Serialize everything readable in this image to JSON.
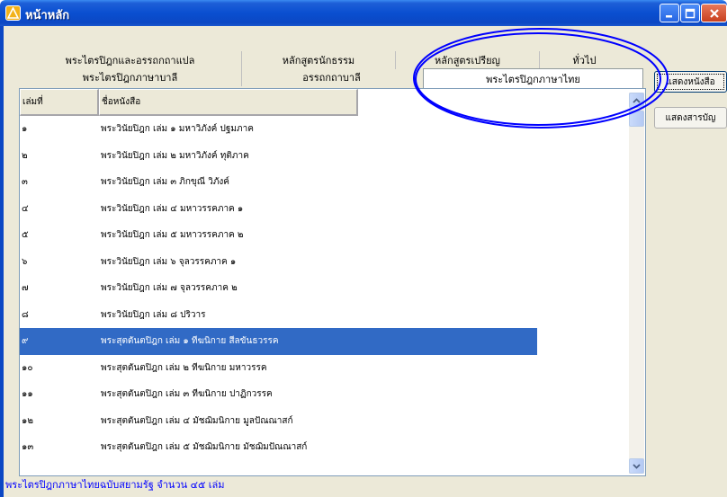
{
  "window": {
    "title": "หน้าหลัก"
  },
  "tabs": {
    "row1": [
      "พระไตรปิฎกและอรรถกถาแปล",
      "หลักสูตรนักธรรม",
      "หลักสูตรเปรียญ",
      "ทั่วไป"
    ],
    "row2": [
      "พระไตรปิฎกภาษาบาลี",
      "อรรถกถาบาลี",
      "พระไตรปิฎกภาษาไทย"
    ]
  },
  "list": {
    "headers": [
      "เล่มที่",
      "ชื่อหนังสือ"
    ],
    "rows": [
      {
        "no": "๑",
        "name": "พระวินัยปิฎก เล่ม ๑ มหาวิภังค์ ปฐมภาค"
      },
      {
        "no": "๒",
        "name": "พระวินัยปิฎก เล่ม ๒ มหาวิภังค์ ทุติภาค"
      },
      {
        "no": "๓",
        "name": "พระวินัยปิฎก เล่ม ๓ ภิกขุณี วิภังค์"
      },
      {
        "no": "๔",
        "name": "พระวินัยปิฎก เล่ม ๔ มหาวรรคภาค ๑"
      },
      {
        "no": "๕",
        "name": "พระวินัยปิฎก เล่ม ๕ มหาวรรคภาค ๒"
      },
      {
        "no": "๖",
        "name": "พระวินัยปิฎก เล่ม ๖ จุลวรรคภาค ๑"
      },
      {
        "no": "๗",
        "name": "พระวินัยปิฎก เล่ม ๗ จุลวรรคภาค ๒"
      },
      {
        "no": "๘",
        "name": "พระวินัยปิฎก เล่ม ๘ ปริวาร"
      },
      {
        "no": "๙",
        "name": "พระสุตตันตปิฎก เล่ม ๑ ทีฆนิกาย สีลขันธวรรค"
      },
      {
        "no": "๑๐",
        "name": "พระสุตตันตปิฎก เล่ม ๒ ทีฆนิกาย มหาวรรค"
      },
      {
        "no": "๑๑",
        "name": "พระสุตตันตปิฎก เล่ม ๓ ทีฆนิกาย ปาฏิกวรรค"
      },
      {
        "no": "๑๒",
        "name": "พระสุตตันตปิฎก เล่ม ๔ มัชฌิมนิกาย มูลปัณณาสก์"
      },
      {
        "no": "๑๓",
        "name": "พระสุตตันตปิฎก เล่ม ๕ มัชฌิมนิกาย มัชฌิมปัณณาสก์"
      }
    ]
  },
  "buttons": {
    "show_book": "แสดงหนังสือ",
    "show_toc": "แสดงสารบัญ"
  },
  "status": "พระไตรปิฎกภาษาไทยฉบับสยามรัฐ จำนวน ๔๕ เล่ม",
  "colors": {
    "selection": "#316ac5",
    "status_text": "#0000ff",
    "annotation": "#0000ff"
  }
}
